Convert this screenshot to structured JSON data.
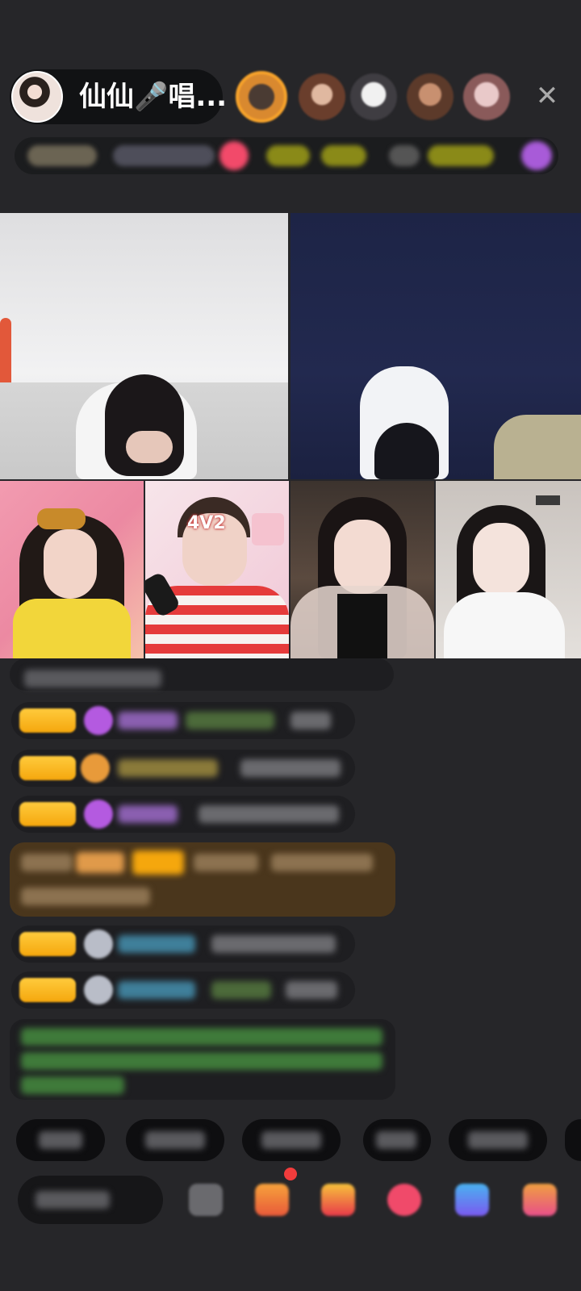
{
  "header": {
    "host_name": "仙仙🎤唱...",
    "close_glyph": "✕"
  },
  "video": {
    "score_badge": "4V2"
  },
  "colors": {
    "background": "#262629",
    "level_badge": "#f5a70d",
    "viewer_ring": "#f7a32b",
    "notify_dot": "#f23c3c"
  }
}
